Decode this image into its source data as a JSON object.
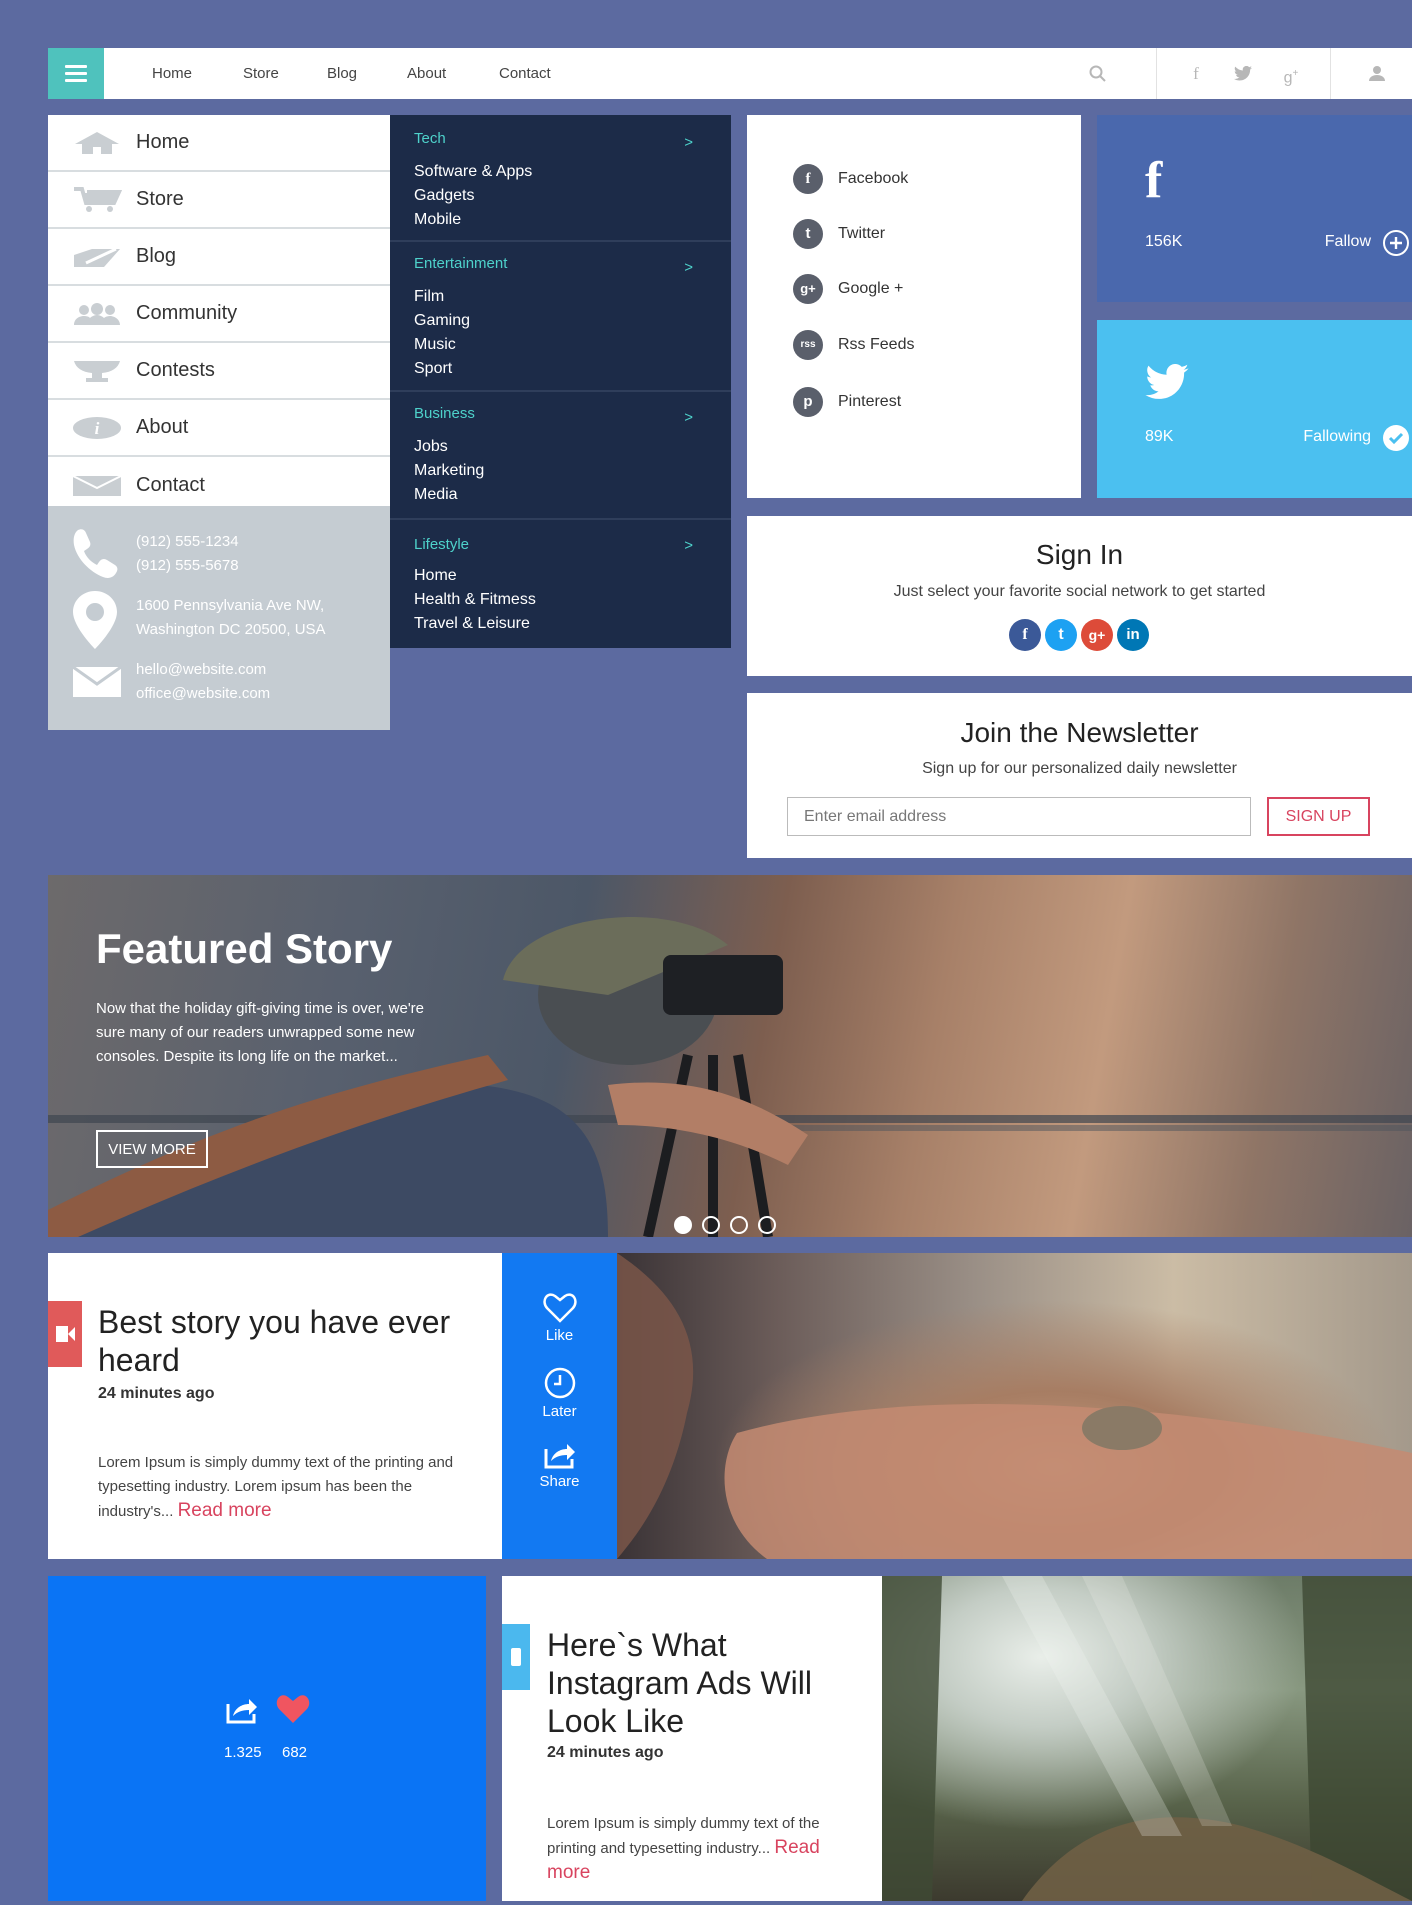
{
  "nav": {
    "links": [
      "Home",
      "Store",
      "Blog",
      "About",
      "Contact"
    ],
    "icons": [
      "search-icon",
      "facebook-icon",
      "twitter-icon",
      "google-plus-icon",
      "user-icon"
    ]
  },
  "side_menu": {
    "items": [
      {
        "label": "Home",
        "icon": "house-icon"
      },
      {
        "label": "Store",
        "icon": "cart-icon"
      },
      {
        "label": "Blog",
        "icon": "pencil-icon"
      },
      {
        "label": "Community",
        "icon": "people-icon"
      },
      {
        "label": "Contests",
        "icon": "trophy-icon"
      },
      {
        "label": "About",
        "icon": "info-icon"
      },
      {
        "label": "Contact",
        "icon": "envelope-icon"
      }
    ]
  },
  "contact": {
    "phone1": "(912) 555-1234",
    "phone2": "(912) 555-5678",
    "address1": "1600 Pennsylvania Ave NW,",
    "address2": "Washington DC 20500, USA",
    "email1": "hello@website.com",
    "email2": "office@website.com"
  },
  "categories": [
    {
      "title": "Tech",
      "arrow": ">",
      "items": [
        "Software & Apps",
        "Gadgets",
        "Mobile"
      ]
    },
    {
      "title": "Entertainment",
      "arrow": ">",
      "items": [
        "Film",
        "Gaming",
        "Music",
        "Sport"
      ]
    },
    {
      "title": "Business",
      "arrow": ">",
      "items": [
        "Jobs",
        "Marketing",
        "Media"
      ]
    },
    {
      "title": "Lifestyle",
      "arrow": ">",
      "items": [
        "Home",
        "Health & Fitmess",
        "Travel & Leisure"
      ]
    }
  ],
  "social_list": [
    {
      "label": "Facebook",
      "glyph": "f"
    },
    {
      "label": "Twitter",
      "glyph": "t"
    },
    {
      "label": "Google +",
      "glyph": "g+"
    },
    {
      "label": "Rss Feeds",
      "glyph": "rss"
    },
    {
      "label": "Pinterest",
      "glyph": "p"
    }
  ],
  "facebook_tile": {
    "count": "156K",
    "action": "Fallow",
    "color": "#4a68ad"
  },
  "twitter_tile": {
    "count": "89K",
    "action": "Fallowing",
    "color": "#4bc0f0"
  },
  "signin": {
    "title": "Sign In",
    "subtitle": "Just select your favorite social network to get started",
    "buttons": [
      {
        "glyph": "f",
        "color": "#3b5998"
      },
      {
        "glyph": "t",
        "color": "#1da1f2"
      },
      {
        "glyph": "g+",
        "color": "#dd4b39"
      },
      {
        "glyph": "in",
        "color": "#0077b5"
      }
    ]
  },
  "newsletter": {
    "title": "Join the Newsletter",
    "subtitle": "Sign up for our personalized daily newsletter",
    "placeholder": "Enter email address",
    "button": "SIGN UP"
  },
  "featured": {
    "title": "Featured Story",
    "text": "Now that the holiday gift-giving time is over, we're sure many of our readers unwrapped some new consoles. Despite its long life on the market...",
    "button": "VIEW MORE",
    "slides": 4,
    "active_slide": 1
  },
  "story1": {
    "title": "Best story you have ever heard",
    "time": "24 minutes ago",
    "excerpt": "Lorem Ipsum is simply dummy text of the printing and typesetting industry. Lorem ipsum has been the industry's...",
    "read_more": "Read more"
  },
  "actions": {
    "like": "Like",
    "later": "Later",
    "share": "Share"
  },
  "stats": {
    "shares": "1.325",
    "likes": "682"
  },
  "story2": {
    "title": "Here`s What Instagram Ads Will Look Like",
    "time": "24 minutes ago",
    "excerpt": "Lorem Ipsum is simply dummy text of the printing and typesetting industry...",
    "read_more": "Read more"
  },
  "colors": {
    "background": "#5c6aa0",
    "accent_teal": "#4fc2bd",
    "dark_menu": "#1c2b48",
    "cta_red": "#d8445f",
    "action_blue": "#1279f2"
  }
}
